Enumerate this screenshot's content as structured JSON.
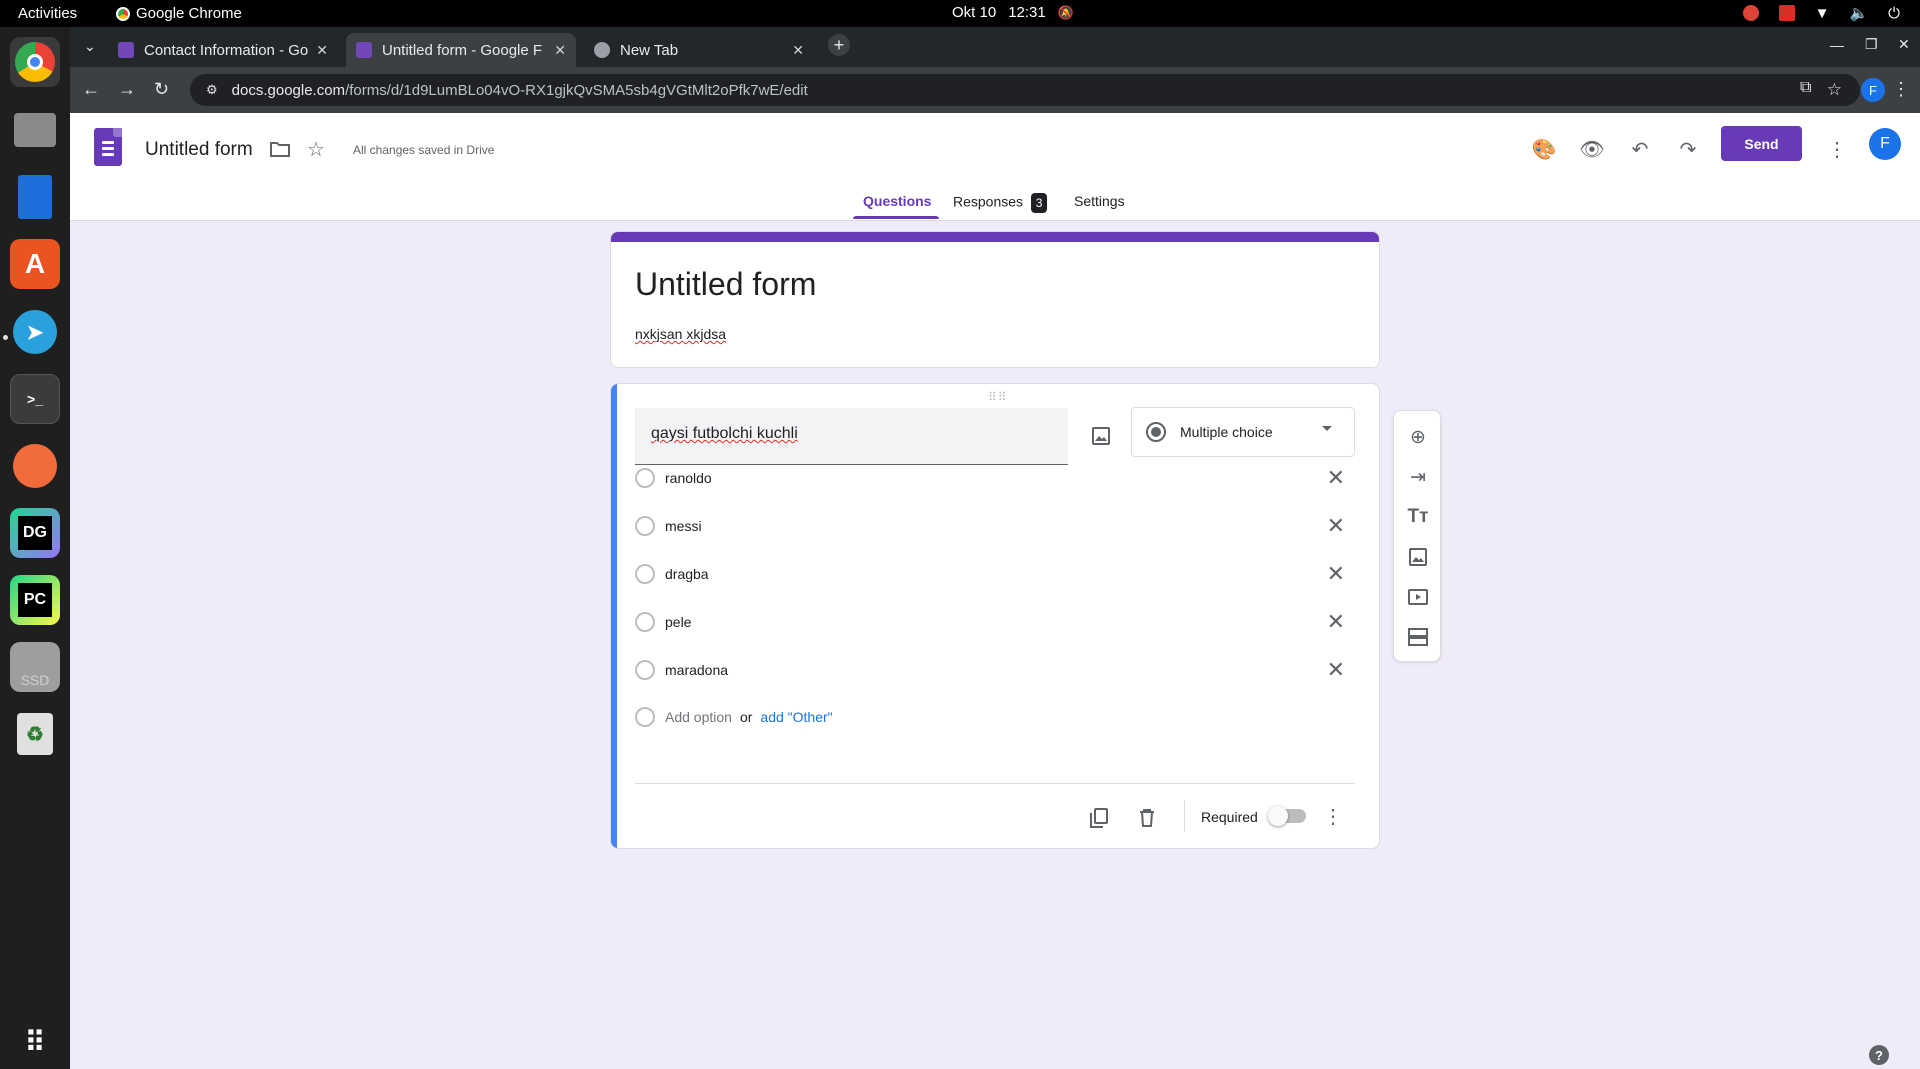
{
  "system": {
    "activities": "Activities",
    "app_name": "Google Chrome",
    "date": "Okt 10",
    "time": "12:31"
  },
  "browser": {
    "tabs": [
      {
        "label": "Contact Information - Go"
      },
      {
        "label": "Untitled form - Google F"
      },
      {
        "label": "New Tab"
      }
    ],
    "url_host": "docs.google.com",
    "url_path": "/forms/d/1d9LumBLo04vO-RX1gjkQvSMA5sb4gVGtMlt2oPfk7wE/edit",
    "profile_initial": "F"
  },
  "header": {
    "title": "Untitled form",
    "saved_status": "All changes saved in Drive",
    "send_label": "Send",
    "avatar_initial": "F",
    "tabs": [
      {
        "label": "Questions"
      },
      {
        "label": "Responses",
        "badge": "3"
      },
      {
        "label": "Settings"
      }
    ],
    "accent_color": "#673ab7"
  },
  "form": {
    "title": "Untitled form",
    "description": "nxkjsan xkjdsa"
  },
  "question": {
    "text": "qaysi futbolchi kuchli",
    "type": "Multiple choice",
    "options": [
      "ranoldo",
      "messi",
      "dragba",
      "pele",
      "maradona"
    ],
    "add_option": "Add option",
    "or": "or",
    "add_other": "add \"Other\"",
    "required_label": "Required",
    "required": false
  }
}
